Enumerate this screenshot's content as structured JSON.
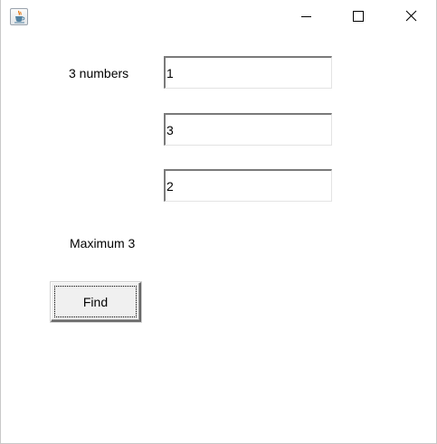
{
  "window": {
    "icon": "java-cup-icon",
    "controls": [
      "minimize-icon",
      "maximize-icon",
      "close-icon"
    ]
  },
  "form": {
    "prompt_label": "3 numbers",
    "inputs": [
      "1",
      "3",
      "2"
    ],
    "result_label": "Maximum 3",
    "find_button": "Find"
  }
}
